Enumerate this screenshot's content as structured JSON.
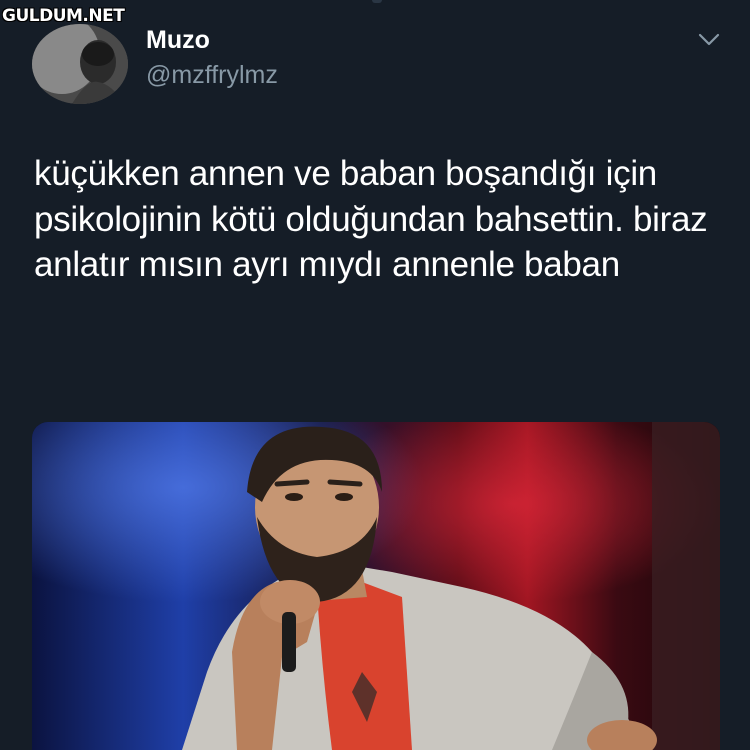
{
  "watermark": "GULDUM.NET",
  "tweet": {
    "author": {
      "display_name": "Muzo",
      "handle": "@mzffrylmz"
    },
    "text": "küçükken annen ve baban boşandığı için psikolojinin kötü olduğundan bahsettin. biraz anlatır mısın ayrı mıydı annenle baban",
    "menu_icon": "chevron-down-icon",
    "media_description": ""
  },
  "colors": {
    "background": "#151d27",
    "text_primary": "#ffffff",
    "text_secondary": "#8899a6"
  }
}
